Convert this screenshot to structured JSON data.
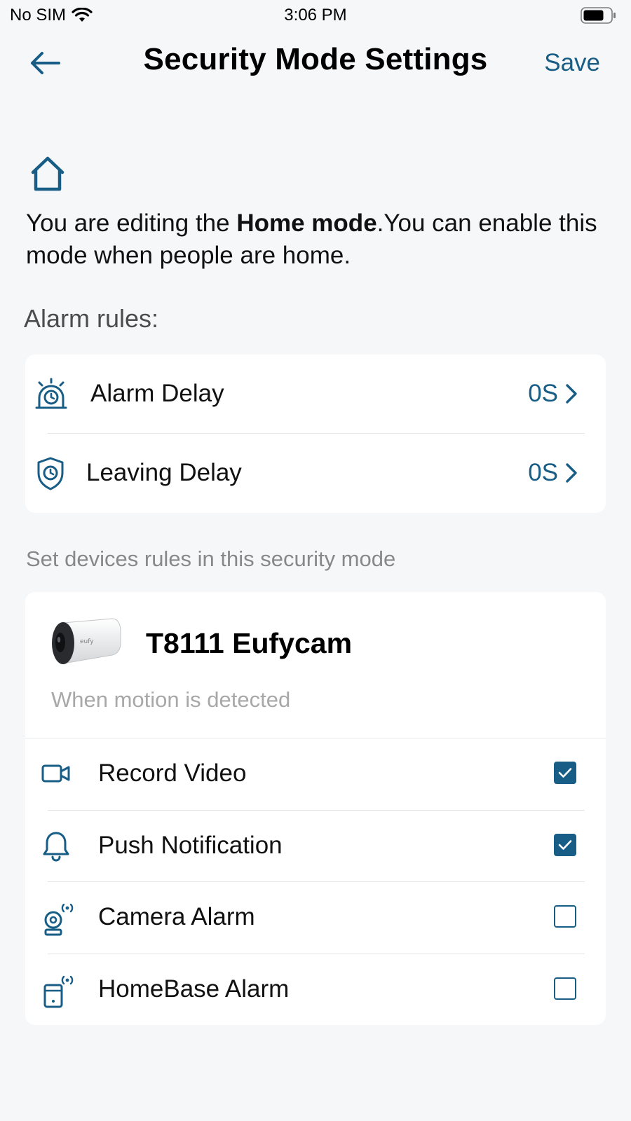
{
  "status_bar": {
    "carrier": "No SIM",
    "time": "3:06 PM"
  },
  "nav": {
    "title": "Security Mode Settings",
    "save_label": "Save"
  },
  "mode": {
    "icon": "home-icon",
    "text_prefix": "You are editing the ",
    "mode_name": "Home mode",
    "text_suffix": ".You can enable this mode when people are home."
  },
  "alarm_rules": {
    "title": "Alarm rules:",
    "items": [
      {
        "icon": "alarm-clock-icon",
        "label": "Alarm Delay",
        "value": "0S"
      },
      {
        "icon": "shield-clock-icon",
        "label": "Leaving Delay",
        "value": "0S"
      }
    ]
  },
  "devices_hint": "Set devices rules in this security mode",
  "device": {
    "name": "T8111 Eufycam",
    "trigger": "When motion is detected",
    "brand_mark": "eufy",
    "actions": [
      {
        "icon": "video-camera-icon",
        "label": "Record Video",
        "checked": true
      },
      {
        "icon": "bell-icon",
        "label": "Push Notification",
        "checked": true
      },
      {
        "icon": "camera-alarm-icon",
        "label": "Camera Alarm",
        "checked": false
      },
      {
        "icon": "homebase-alarm-icon",
        "label": "HomeBase Alarm",
        "checked": false
      }
    ]
  },
  "colors": {
    "accent": "#175d86",
    "background": "#f6f7f9",
    "card": "#ffffff"
  }
}
